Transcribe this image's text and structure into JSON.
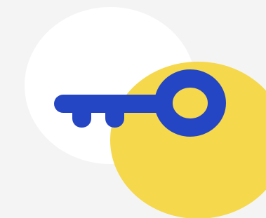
{
  "illustration": {
    "subject": "key-icon",
    "colors": {
      "background": "#f4f4f4",
      "white_circle": "#ffffff",
      "yellow_circle": "#f5d84b",
      "key": "#2546c4"
    }
  }
}
